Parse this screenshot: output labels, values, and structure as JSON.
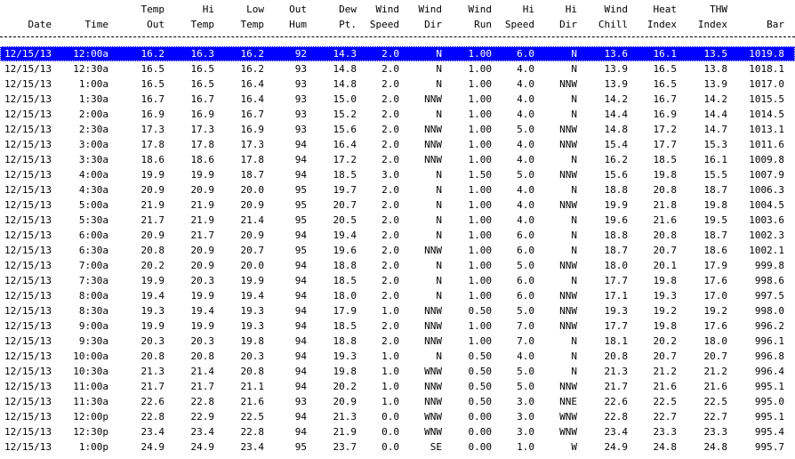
{
  "headers": [
    [
      "",
      "Date"
    ],
    [
      "",
      "Time"
    ],
    [
      "Temp",
      "Out"
    ],
    [
      "Hi",
      "Temp"
    ],
    [
      "Low",
      "Temp"
    ],
    [
      "Out",
      "Hum"
    ],
    [
      "Dew",
      "Pt."
    ],
    [
      "Wind",
      "Speed"
    ],
    [
      "Wind",
      "Dir"
    ],
    [
      "Wind",
      "Run"
    ],
    [
      "Hi",
      "Speed"
    ],
    [
      "Hi",
      "Dir"
    ],
    [
      "Wind",
      "Chill"
    ],
    [
      "Heat",
      "Index"
    ],
    [
      "THW",
      "Index"
    ],
    [
      "",
      "Bar"
    ]
  ],
  "divider_text": "--------------------------------------------------------------------------------------------------------------------------------",
  "rows": [
    [
      "12/15/13",
      "12:00a",
      "16.2",
      "16.3",
      "16.2",
      "92",
      "14.3",
      "2.0",
      "N",
      "1.00",
      "6.0",
      "N",
      "13.6",
      "16.1",
      "13.5",
      "1019.8"
    ],
    [
      "12/15/13",
      "12:30a",
      "16.5",
      "16.5",
      "16.2",
      "93",
      "14.8",
      "2.0",
      "N",
      "1.00",
      "4.0",
      "N",
      "13.9",
      "16.5",
      "13.8",
      "1018.1"
    ],
    [
      "12/15/13",
      "1:00a",
      "16.5",
      "16.5",
      "16.4",
      "93",
      "14.8",
      "2.0",
      "N",
      "1.00",
      "4.0",
      "NNW",
      "13.9",
      "16.5",
      "13.9",
      "1017.0"
    ],
    [
      "12/15/13",
      "1:30a",
      "16.7",
      "16.7",
      "16.4",
      "93",
      "15.0",
      "2.0",
      "NNW",
      "1.00",
      "4.0",
      "N",
      "14.2",
      "16.7",
      "14.2",
      "1015.5"
    ],
    [
      "12/15/13",
      "2:00a",
      "16.9",
      "16.9",
      "16.7",
      "93",
      "15.2",
      "2.0",
      "N",
      "1.00",
      "4.0",
      "N",
      "14.4",
      "16.9",
      "14.4",
      "1014.5"
    ],
    [
      "12/15/13",
      "2:30a",
      "17.3",
      "17.3",
      "16.9",
      "93",
      "15.6",
      "2.0",
      "NNW",
      "1.00",
      "5.0",
      "NNW",
      "14.8",
      "17.2",
      "14.7",
      "1013.1"
    ],
    [
      "12/15/13",
      "3:00a",
      "17.8",
      "17.8",
      "17.3",
      "94",
      "16.4",
      "2.0",
      "NNW",
      "1.00",
      "4.0",
      "NNW",
      "15.4",
      "17.7",
      "15.3",
      "1011.6"
    ],
    [
      "12/15/13",
      "3:30a",
      "18.6",
      "18.6",
      "17.8",
      "94",
      "17.2",
      "2.0",
      "NNW",
      "1.00",
      "4.0",
      "N",
      "16.2",
      "18.5",
      "16.1",
      "1009.8"
    ],
    [
      "12/15/13",
      "4:00a",
      "19.9",
      "19.9",
      "18.7",
      "94",
      "18.5",
      "3.0",
      "N",
      "1.50",
      "5.0",
      "NNW",
      "15.6",
      "19.8",
      "15.5",
      "1007.9"
    ],
    [
      "12/15/13",
      "4:30a",
      "20.9",
      "20.9",
      "20.0",
      "95",
      "19.7",
      "2.0",
      "N",
      "1.00",
      "4.0",
      "N",
      "18.8",
      "20.8",
      "18.7",
      "1006.3"
    ],
    [
      "12/15/13",
      "5:00a",
      "21.9",
      "21.9",
      "20.9",
      "95",
      "20.7",
      "2.0",
      "N",
      "1.00",
      "4.0",
      "NNW",
      "19.9",
      "21.8",
      "19.8",
      "1004.5"
    ],
    [
      "12/15/13",
      "5:30a",
      "21.7",
      "21.9",
      "21.4",
      "95",
      "20.5",
      "2.0",
      "N",
      "1.00",
      "4.0",
      "N",
      "19.6",
      "21.6",
      "19.5",
      "1003.6"
    ],
    [
      "12/15/13",
      "6:00a",
      "20.9",
      "21.7",
      "20.9",
      "94",
      "19.4",
      "2.0",
      "N",
      "1.00",
      "6.0",
      "N",
      "18.8",
      "20.8",
      "18.7",
      "1002.3"
    ],
    [
      "12/15/13",
      "6:30a",
      "20.8",
      "20.9",
      "20.7",
      "95",
      "19.6",
      "2.0",
      "NNW",
      "1.00",
      "6.0",
      "N",
      "18.7",
      "20.7",
      "18.6",
      "1002.1"
    ],
    [
      "12/15/13",
      "7:00a",
      "20.2",
      "20.9",
      "20.0",
      "94",
      "18.8",
      "2.0",
      "N",
      "1.00",
      "5.0",
      "NNW",
      "18.0",
      "20.1",
      "17.9",
      "999.8"
    ],
    [
      "12/15/13",
      "7:30a",
      "19.9",
      "20.3",
      "19.9",
      "94",
      "18.5",
      "2.0",
      "N",
      "1.00",
      "6.0",
      "N",
      "17.7",
      "19.8",
      "17.6",
      "998.6"
    ],
    [
      "12/15/13",
      "8:00a",
      "19.4",
      "19.9",
      "19.4",
      "94",
      "18.0",
      "2.0",
      "N",
      "1.00",
      "6.0",
      "NNW",
      "17.1",
      "19.3",
      "17.0",
      "997.5"
    ],
    [
      "12/15/13",
      "8:30a",
      "19.3",
      "19.4",
      "19.3",
      "94",
      "17.9",
      "1.0",
      "NNW",
      "0.50",
      "5.0",
      "NNW",
      "19.3",
      "19.2",
      "19.2",
      "998.0"
    ],
    [
      "12/15/13",
      "9:00a",
      "19.9",
      "19.9",
      "19.3",
      "94",
      "18.5",
      "2.0",
      "NNW",
      "1.00",
      "7.0",
      "NNW",
      "17.7",
      "19.8",
      "17.6",
      "996.2"
    ],
    [
      "12/15/13",
      "9:30a",
      "20.3",
      "20.3",
      "19.8",
      "94",
      "18.8",
      "2.0",
      "NNW",
      "1.00",
      "7.0",
      "N",
      "18.1",
      "20.2",
      "18.0",
      "996.1"
    ],
    [
      "12/15/13",
      "10:00a",
      "20.8",
      "20.8",
      "20.3",
      "94",
      "19.3",
      "1.0",
      "N",
      "0.50",
      "4.0",
      "N",
      "20.8",
      "20.7",
      "20.7",
      "996.8"
    ],
    [
      "12/15/13",
      "10:30a",
      "21.3",
      "21.4",
      "20.8",
      "94",
      "19.8",
      "1.0",
      "WNW",
      "0.50",
      "5.0",
      "N",
      "21.3",
      "21.2",
      "21.2",
      "996.4"
    ],
    [
      "12/15/13",
      "11:00a",
      "21.7",
      "21.7",
      "21.1",
      "94",
      "20.2",
      "1.0",
      "NNW",
      "0.50",
      "5.0",
      "NNW",
      "21.7",
      "21.6",
      "21.6",
      "995.1"
    ],
    [
      "12/15/13",
      "11:30a",
      "22.6",
      "22.8",
      "21.6",
      "93",
      "20.9",
      "1.0",
      "NNW",
      "0.50",
      "3.0",
      "NNE",
      "22.6",
      "22.5",
      "22.5",
      "995.0"
    ],
    [
      "12/15/13",
      "12:00p",
      "22.8",
      "22.9",
      "22.5",
      "94",
      "21.3",
      "0.0",
      "WNW",
      "0.00",
      "3.0",
      "WNW",
      "22.8",
      "22.7",
      "22.7",
      "995.1"
    ],
    [
      "12/15/13",
      "12:30p",
      "23.4",
      "23.4",
      "22.8",
      "94",
      "21.9",
      "0.0",
      "WNW",
      "0.00",
      "3.0",
      "WNW",
      "23.4",
      "23.3",
      "23.3",
      "995.4"
    ],
    [
      "12/15/13",
      "1:00p",
      "24.9",
      "24.9",
      "23.4",
      "95",
      "23.7",
      "0.0",
      "SE",
      "0.00",
      "1.0",
      "W",
      "24.9",
      "24.8",
      "24.8",
      "995.7"
    ]
  ],
  "selected_row": 0
}
